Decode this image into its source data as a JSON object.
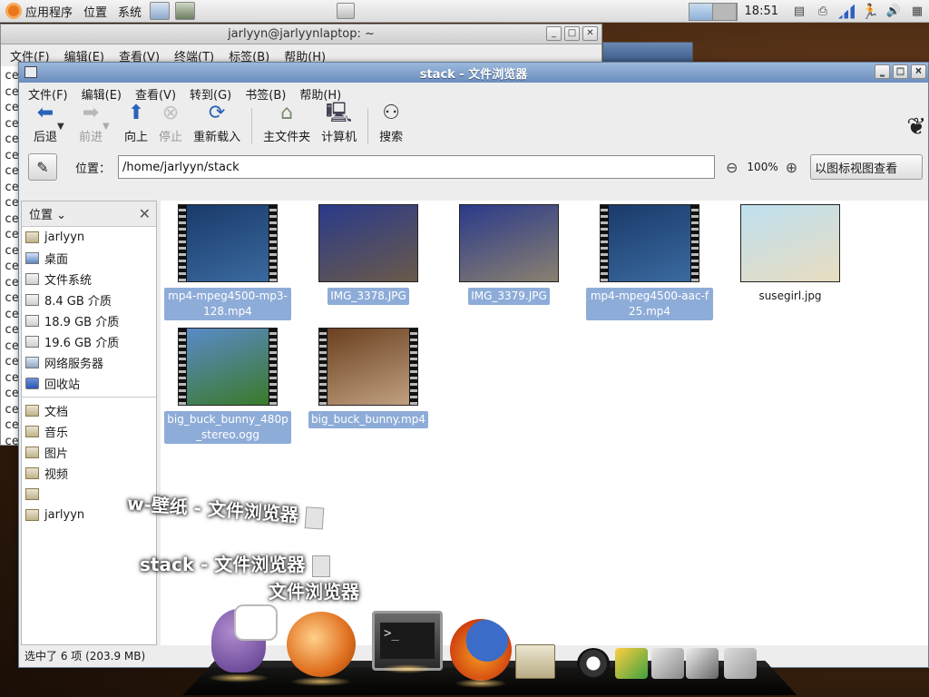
{
  "top_panel": {
    "menu_apps": "应用程序",
    "menu_places": "位置",
    "menu_system": "系统",
    "clock": "18:51"
  },
  "terminal": {
    "title": "jarlyyn@jarlyynlaptop: ~",
    "menu": [
      "文件(F)",
      "编辑(E)",
      "查看(V)",
      "终端(T)",
      "标签(B)",
      "帮助(H)"
    ],
    "line_prefix": "ce"
  },
  "window": {
    "title": "stack - 文件浏览器",
    "menu": [
      "文件(F)",
      "编辑(E)",
      "查看(V)",
      "转到(G)",
      "书签(B)",
      "帮助(H)"
    ]
  },
  "toolbar": {
    "back": "后退",
    "forward": "前进",
    "up": "向上",
    "stop": "停止",
    "reload": "重新载入",
    "home": "主文件夹",
    "computer": "计算机",
    "search": "搜索"
  },
  "location": {
    "label": "位置：",
    "path": "/home/jarlyyn/stack",
    "zoom": "100%",
    "view_mode": "以图标视图查看"
  },
  "sidebar": {
    "header": "位置",
    "items": [
      {
        "label": "jarlyyn",
        "icon": "home-folder-icon"
      },
      {
        "label": "桌面",
        "icon": "desktop-icon"
      },
      {
        "label": "文件系统",
        "icon": "drive-icon"
      },
      {
        "label": "8.4 GB 介质",
        "icon": "drive-icon"
      },
      {
        "label": "18.9 GB 介质",
        "icon": "drive-icon"
      },
      {
        "label": "19.6 GB 介质",
        "icon": "drive-icon"
      },
      {
        "label": "网络服务器",
        "icon": "network-icon"
      },
      {
        "label": "回收站",
        "icon": "trash-icon"
      }
    ],
    "bookmarks": [
      {
        "label": "文档"
      },
      {
        "label": "音乐"
      },
      {
        "label": "图片"
      },
      {
        "label": "视频"
      },
      {
        "label": ""
      },
      {
        "label": "jarlyyn"
      }
    ]
  },
  "files": [
    {
      "name": "mp4-mpeg4500-mp3-128.mp4",
      "kind": "video",
      "selected": true,
      "colors": [
        "#1a3a6a",
        "#3a6aa0"
      ]
    },
    {
      "name": "IMG_3378.JPG",
      "kind": "image",
      "selected": true,
      "colors": [
        "#2a3a8a",
        "#6a5a4a"
      ]
    },
    {
      "name": "IMG_3379.JPG",
      "kind": "image",
      "selected": true,
      "colors": [
        "#2a3a8a",
        "#8a8070"
      ]
    },
    {
      "name": "mp4-mpeg4500-aac-f25.mp4",
      "kind": "video",
      "selected": true,
      "colors": [
        "#1a3a6a",
        "#3a6aa0"
      ]
    },
    {
      "name": "susegirl.jpg",
      "kind": "image",
      "selected": false,
      "colors": [
        "#bfe0f0",
        "#e8dcc0"
      ]
    },
    {
      "name": "big_buck_bunny_480p_stereo.ogg",
      "kind": "video",
      "selected": true,
      "colors": [
        "#5a8ac8",
        "#3a7a2a"
      ]
    },
    {
      "name": "big_buck_bunny.mp4",
      "kind": "video",
      "selected": true,
      "colors": [
        "#6a4020",
        "#c0a080"
      ]
    }
  ],
  "status": "选中了 6 项 (203.9 MB)",
  "switcher": {
    "item1": "w-壁纸 - 文件浏览器",
    "item2": "stack - 文件浏览器",
    "current": "文件浏览器"
  }
}
